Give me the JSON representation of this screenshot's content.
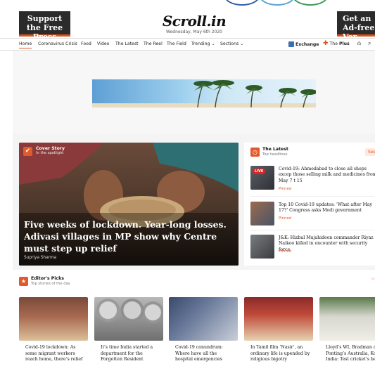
{
  "promo": {
    "left": "Support the Free Press",
    "right": "Get an Ad-free Ver"
  },
  "logo": {
    "name": "Scroll.in",
    "date": "Wednesday, May 6th 2020"
  },
  "nav": {
    "items": [
      "Home",
      "Coronavirus Crisis",
      "Food",
      "Video",
      "The Latest",
      "The Reel",
      "The Field",
      "Trending ⌄",
      "Sections ⌄"
    ],
    "exchange": "Exchange",
    "plus_prefix": "The",
    "plus_bold": "Plus"
  },
  "cover": {
    "title": "Cover Story",
    "subtitle": "In the spotlight",
    "headline": "Five weeks of lockdown. Year-long losses. Adivasi villages in MP show why Centre must step up relief",
    "author": "Supriya Sharma"
  },
  "latest": {
    "title": "The Latest",
    "subtitle": "Top headlines",
    "see": "See",
    "live_label": "LIVE",
    "items": [
      {
        "text": "Covid-19: Ahmedabad to close all shops excep those selling milk and medicines from May 7 t 15",
        "tag": "Pinned"
      },
      {
        "text": "Top 10 Covid-19 updates: ‘What after May 17?’ Congress asks Modi government",
        "tag": "Pinned"
      },
      {
        "text": "J&K: Hizbul Mujahideen commander Riyaz Naikoo killed in encounter with security force",
        "tag": "Pinned"
      }
    ]
  },
  "picks": {
    "title": "Editor's Picks",
    "subtitle": "Top stories of the day",
    "cards": [
      "Covid-19 lockdown: As some migrant workers reach home, there’s relief",
      "It’s time India started a department for the Forgotten Resident",
      "Covid-19 conundrum: Where have all the hospital emergencies",
      "In Tamil film ‘Nasir’, an ordinary life is upended by religious bigotry",
      "Lloyd’s WI, Bradman an Ponting’s Australia, Kol India: Test cricket’s bes"
    ]
  },
  "colors": {
    "accent": "#e15a2b",
    "dark": "#2b2b2b",
    "live": "#e02424"
  }
}
